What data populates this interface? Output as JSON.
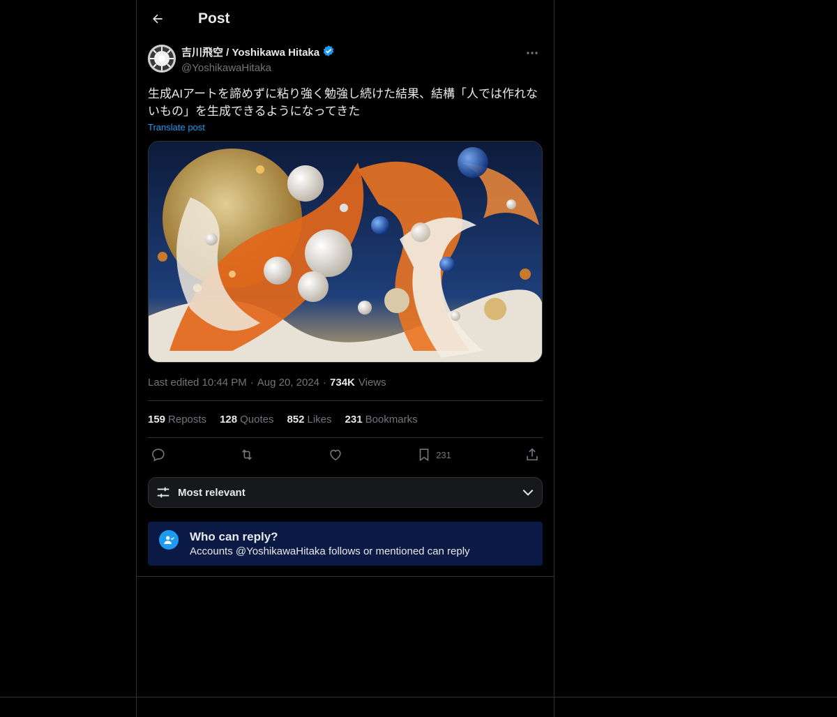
{
  "header": {
    "title": "Post"
  },
  "author": {
    "name": "吉川飛空 / Yoshikawa Hitaka",
    "handle": "@YoshikawaHitaka"
  },
  "post": {
    "text": "生成AIアートを諦めずに粘り強く勉強し続けた結果、結構「人では作れないもの」を生成できるようになってきた",
    "translate_label": "Translate post"
  },
  "meta": {
    "edited": "Last edited 10:44 PM",
    "date": "Aug 20, 2024",
    "views_count": "734K",
    "views_label": "Views"
  },
  "stats": [
    {
      "count": "159",
      "label": "Reposts"
    },
    {
      "count": "128",
      "label": "Quotes"
    },
    {
      "count": "852",
      "label": "Likes"
    },
    {
      "count": "231",
      "label": "Bookmarks"
    }
  ],
  "actions": {
    "bookmark_count": "231"
  },
  "sort": {
    "label": "Most relevant"
  },
  "reply_notice": {
    "title": "Who can reply?",
    "subtitle": "Accounts @YoshikawaHitaka follows or mentioned can reply"
  },
  "colors": {
    "accent": "#1d9bf0",
    "background": "#000000",
    "notice_bg": "#0b1a44"
  }
}
